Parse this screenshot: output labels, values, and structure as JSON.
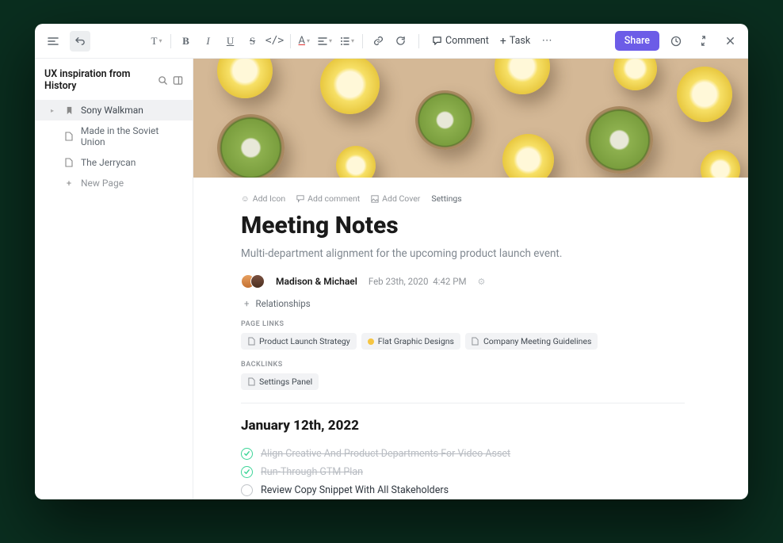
{
  "toolbar": {
    "comment_label": "Comment",
    "task_label": "Task",
    "share_label": "Share"
  },
  "sidebar": {
    "title": "UX inspiration from History",
    "items": [
      {
        "label": "Sony Walkman",
        "active": true,
        "type": "parent"
      },
      {
        "label": "Made in the Soviet Union",
        "type": "sub"
      },
      {
        "label": "The Jerrycan",
        "type": "sub"
      }
    ],
    "new_page_label": "New Page"
  },
  "page": {
    "actions": {
      "add_icon": "Add Icon",
      "add_comment": "Add comment",
      "add_cover": "Add Cover",
      "settings": "Settings"
    },
    "title": "Meeting Notes",
    "subtitle": "Multi-department alignment for the upcoming product launch event.",
    "authors": "Madison & Michael",
    "date": "Feb 23th, 2020",
    "time": "4:42 PM",
    "relationships_label": "Relationships",
    "page_links_label": "PAGE LINKS",
    "page_links": [
      {
        "label": "Product Launch Strategy",
        "icon": "doc"
      },
      {
        "label": "Flat Graphic Designs",
        "icon": "dot"
      },
      {
        "label": "Company Meeting Guidelines",
        "icon": "doc"
      }
    ],
    "backlinks_label": "BACKLINKS",
    "backlinks": [
      {
        "label": "Settings Panel",
        "icon": "doc"
      }
    ],
    "date_heading": "January 12th, 2022",
    "tasks": [
      {
        "text": "Align Creative And Product Departments For Video Asset",
        "done": true
      },
      {
        "text": "Run-Through GTM Plan",
        "done": true
      },
      {
        "text": "Review Copy Snippet With All Stakeholders",
        "done": false
      }
    ]
  }
}
